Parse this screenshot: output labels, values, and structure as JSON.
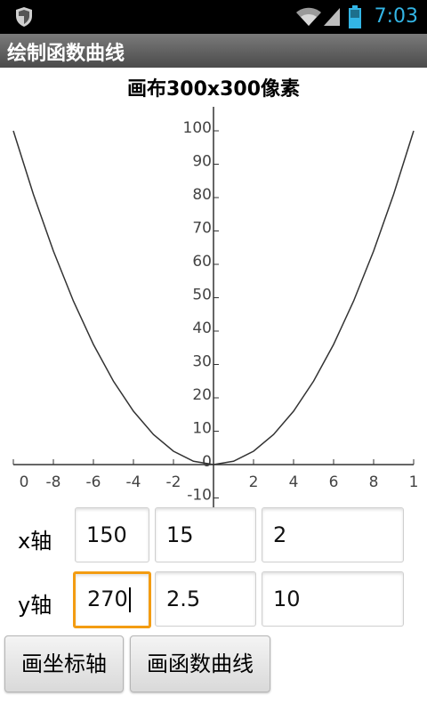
{
  "status_bar": {
    "time": "7:03",
    "icons": [
      "shield-icon",
      "wifi-icon",
      "signal-icon",
      "battery-icon"
    ]
  },
  "app": {
    "title": "绘制函数曲线"
  },
  "canvas": {
    "caption": "画布300x300像素"
  },
  "chart_data": {
    "type": "line",
    "x_tick_labels": [
      "0",
      "-8",
      "-6",
      "-4",
      "-2",
      "2",
      "4",
      "6",
      "8",
      "1"
    ],
    "y_tick_labels": [
      "-10",
      "0",
      "10",
      "20",
      "30",
      "40",
      "50",
      "60",
      "70",
      "80",
      "90",
      "100"
    ],
    "xlim": [
      -10,
      10
    ],
    "ylim": [
      -10,
      100
    ],
    "series": [
      {
        "x": [
          -10,
          -9,
          -8,
          -7,
          -6,
          -5,
          -4,
          -3,
          -2,
          -1,
          0,
          1,
          2,
          3,
          4,
          5,
          6,
          7,
          8,
          9,
          10
        ],
        "y": [
          100,
          81,
          64,
          49,
          36,
          25,
          16,
          9,
          4,
          1,
          0,
          1,
          4,
          9,
          16,
          25,
          36,
          49,
          64,
          81,
          100
        ]
      }
    ],
    "grid": false,
    "colors": {
      "curve": "#333333",
      "axis": "#333333",
      "ticks": "#444444"
    }
  },
  "form": {
    "x_axis": {
      "label": "x轴",
      "values": [
        "150",
        "15",
        "2"
      ]
    },
    "y_axis": {
      "label": "y轴",
      "values": [
        "270",
        "2.5",
        "10"
      ]
    }
  },
  "buttons": {
    "draw_axes": "画坐标轴",
    "draw_curve": "画函数曲线"
  },
  "colors": {
    "focus": "#f39c12",
    "clock": "#33b5e5"
  }
}
